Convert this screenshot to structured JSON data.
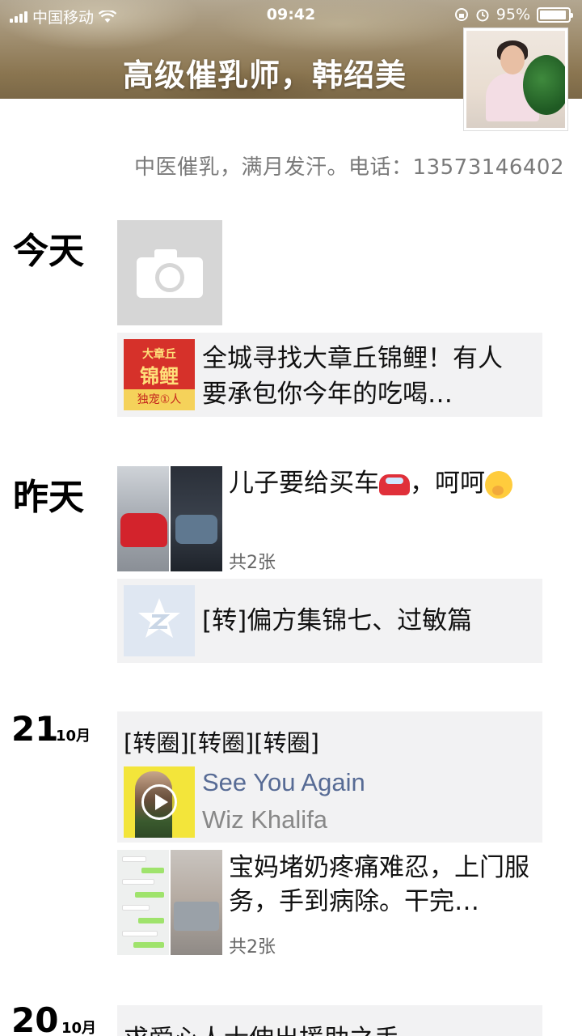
{
  "status_bar": {
    "carrier": "中国移动",
    "time": "09:42",
    "battery": "95%",
    "battery_level": 0.95
  },
  "profile": {
    "name": "高级催乳师，韩绍美",
    "signature": "中医催乳，满月发汗。电话：13573146402"
  },
  "timeline": {
    "today": {
      "label": "今天",
      "share": {
        "thumb_line1": "大章丘",
        "thumb_line2": "锦鲤",
        "thumb_line3": "独宠①人",
        "text": "全城寻找大章丘锦鲤！有人要承包你今年的吃喝…"
      }
    },
    "yesterday": {
      "label": "昨天",
      "post": {
        "text": "儿子要给买车",
        "text_end": "，呵呵",
        "count": "共2张"
      },
      "share": {
        "text": "[转]偏方集锦七、过敏篇"
      }
    },
    "oct21": {
      "day": "21",
      "month": "10月",
      "music": {
        "caption": "[转圈][转圈][转圈]",
        "title": "See You Again",
        "artist": "Wiz Khalifa"
      },
      "post": {
        "text": "宝妈堵奶疼痛难忍，上门服务，手到病除。干完…",
        "count": "共2张"
      }
    },
    "oct20": {
      "day": "20",
      "month": "10月",
      "text": "求爱心人士伸出援助之手"
    }
  }
}
